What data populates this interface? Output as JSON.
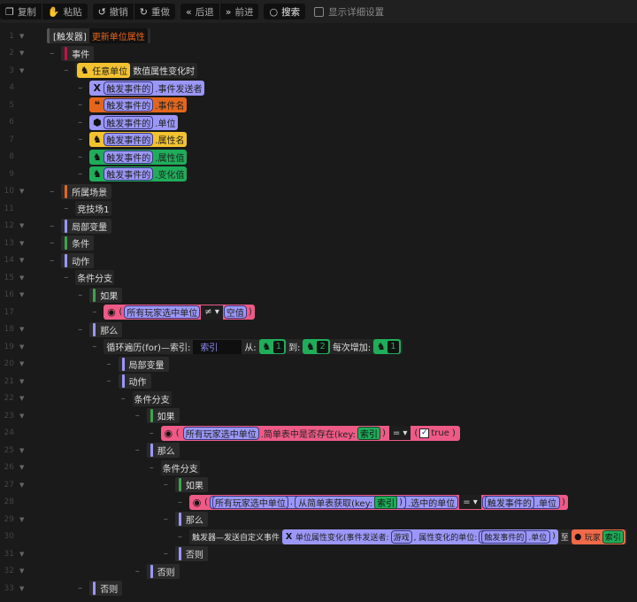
{
  "toolbar": {
    "copy": "复制",
    "paste": "粘贴",
    "undo": "撤销",
    "redo": "重做",
    "back": "后退",
    "forward": "前进",
    "search": "搜索",
    "show_details": "显示详细设置"
  },
  "colors": {
    "purple": "#9b97f7",
    "orange": "#e4661c",
    "yellow": "#f3c22f",
    "green": "#1fad5a",
    "pink": "#ee5a86",
    "event_red": "#c0144a"
  },
  "rows": [
    {
      "n": "1",
      "lv": 0,
      "ar": true,
      "c": [
        {
          "k": "hdr",
          "c": [
            {
              "k": "t",
              "t": "[触发器]"
            },
            {
              "k": "darkorange",
              "t": "更新单位属性"
            }
          ]
        }
      ]
    },
    {
      "n": "2",
      "lv": 1,
      "ar": true,
      "c": [
        {
          "k": "bar",
          "bc": "#c0144a",
          "t": "事件"
        }
      ]
    },
    {
      "n": "3",
      "lv": 2,
      "ar": true,
      "c": [
        {
          "k": "grp",
          "c": [
            {
              "k": "blk yellow",
              "c": [
                {
                  "k": "icon",
                  "i": "unit-icon"
                },
                {
                  "k": "t",
                  "t": "任意单位"
                }
              ]
            },
            {
              "k": "t",
              "t": "数值属性变化时"
            }
          ]
        }
      ]
    },
    {
      "n": "4",
      "lv": 3,
      "c": [
        {
          "k": "blk purple",
          "c": [
            {
              "k": "icon",
              "i": "x-icon"
            },
            {
              "k": "pbox",
              "t": "触发事件的"
            },
            {
              "k": "t",
              "t": ".事件发送者"
            }
          ]
        }
      ]
    },
    {
      "n": "5",
      "lv": 3,
      "c": [
        {
          "k": "blk orange",
          "c": [
            {
              "k": "icon",
              "i": "quote-icon"
            },
            {
              "k": "pbox",
              "t": "触发事件的"
            },
            {
              "k": "t",
              "t": ".事件名"
            }
          ]
        }
      ]
    },
    {
      "n": "6",
      "lv": 3,
      "c": [
        {
          "k": "blk purple",
          "c": [
            {
              "k": "icon",
              "i": "cube-icon"
            },
            {
              "k": "pbox",
              "t": "触发事件的"
            },
            {
              "k": "t",
              "t": ".单位"
            }
          ]
        }
      ]
    },
    {
      "n": "7",
      "lv": 3,
      "c": [
        {
          "k": "blk yellow",
          "c": [
            {
              "k": "icon",
              "i": "unit-icon"
            },
            {
              "k": "pbox",
              "t": "触发事件的"
            },
            {
              "k": "t",
              "t": ".属性名"
            }
          ]
        }
      ]
    },
    {
      "n": "8",
      "lv": 3,
      "c": [
        {
          "k": "blk green",
          "c": [
            {
              "k": "icon",
              "i": "unit-icon"
            },
            {
              "k": "pbox",
              "t": "触发事件的"
            },
            {
              "k": "t",
              "t": ".属性值"
            }
          ]
        }
      ]
    },
    {
      "n": "9",
      "lv": 3,
      "c": [
        {
          "k": "blk green",
          "c": [
            {
              "k": "icon",
              "i": "unit-icon"
            },
            {
              "k": "pbox",
              "t": "触发事件的"
            },
            {
              "k": "t",
              "t": ".变化值"
            }
          ]
        }
      ]
    },
    {
      "n": "10",
      "lv": 1,
      "ar": true,
      "c": [
        {
          "k": "bar",
          "bc": "#e4661c",
          "t": "所属场景"
        }
      ]
    },
    {
      "n": "11",
      "lv": 2,
      "c": [
        {
          "k": "grp",
          "t": "竞技场1"
        }
      ]
    },
    {
      "n": "12",
      "lv": 1,
      "ar": true,
      "c": [
        {
          "k": "bar",
          "bc": "#9b97f7",
          "t": "局部变量"
        }
      ]
    },
    {
      "n": "13",
      "lv": 1,
      "ar": true,
      "c": [
        {
          "k": "bar",
          "bc": "#3fa34d",
          "t": "条件"
        }
      ]
    },
    {
      "n": "14",
      "lv": 1,
      "ar": true,
      "c": [
        {
          "k": "bar",
          "bc": "#9b97f7",
          "t": "动作"
        }
      ]
    },
    {
      "n": "15",
      "lv": 2,
      "ar": true,
      "c": [
        {
          "k": "grp",
          "t": "条件分支"
        }
      ]
    },
    {
      "n": "16",
      "lv": 3,
      "ar": true,
      "c": [
        {
          "k": "bar",
          "bc": "#3fa34d",
          "t": "如果"
        }
      ]
    },
    {
      "n": "17",
      "lv": 4,
      "c": [
        {
          "k": "blk pink",
          "c": [
            {
              "k": "icon",
              "i": "eye-icon"
            },
            {
              "k": "t",
              "t": "("
            },
            {
              "k": "pbox",
              "t": "所有玩家选中单位"
            },
            {
              "k": "dd",
              "t": "≠ ▾"
            },
            {
              "k": "pbox",
              "t": "空值"
            },
            {
              "k": "t",
              "t": ")"
            }
          ]
        }
      ]
    },
    {
      "n": "18",
      "lv": 3,
      "ar": true,
      "c": [
        {
          "k": "bar",
          "bc": "#9b97f7",
          "t": "那么"
        }
      ]
    },
    {
      "n": "19",
      "lv": 4,
      "ar": true,
      "c": [
        {
          "k": "grp",
          "c": [
            {
              "k": "t",
              "t": "循环遍历(for)—索引:"
            },
            {
              "k": "input",
              "t": "索引"
            },
            {
              "k": "t",
              "t": "从:"
            },
            {
              "k": "blk green",
              "c": [
                {
                  "k": "icon",
                  "i": "unit-icon"
                },
                {
                  "k": "num",
                  "t": "1"
                }
              ]
            },
            {
              "k": "t",
              "t": "到:"
            },
            {
              "k": "blk green",
              "c": [
                {
                  "k": "icon",
                  "i": "unit-icon"
                },
                {
                  "k": "num",
                  "t": "2"
                }
              ]
            },
            {
              "k": "t",
              "t": "每次增加:"
            },
            {
              "k": "blk green",
              "c": [
                {
                  "k": "icon",
                  "i": "unit-icon"
                },
                {
                  "k": "num",
                  "t": "1"
                }
              ]
            }
          ]
        }
      ]
    },
    {
      "n": "20",
      "lv": 5,
      "ar": true,
      "c": [
        {
          "k": "bar",
          "bc": "#9b97f7",
          "t": "局部变量"
        }
      ]
    },
    {
      "n": "21",
      "lv": 5,
      "ar": true,
      "c": [
        {
          "k": "bar",
          "bc": "#9b97f7",
          "t": "动作"
        }
      ]
    },
    {
      "n": "22",
      "lv": 6,
      "ar": true,
      "c": [
        {
          "k": "grp",
          "t": "条件分支"
        }
      ]
    },
    {
      "n": "23",
      "lv": 7,
      "ar": true,
      "c": [
        {
          "k": "bar",
          "bc": "#3fa34d",
          "t": "如果"
        }
      ]
    },
    {
      "n": "24",
      "lv": 8,
      "c": [
        {
          "k": "blk pink",
          "c": [
            {
              "k": "icon",
              "i": "eye-icon"
            },
            {
              "k": "t",
              "t": "("
            },
            {
              "k": "blk pink",
              "c": [
                {
                  "k": "pbox",
                  "t": "所有玩家选中单位"
                },
                {
                  "k": "t",
                  "t": ".简单表中是否存在(key:"
                },
                {
                  "k": "gbox",
                  "t": "索引"
                },
                {
                  "k": "t",
                  "t": ")"
                }
              ]
            },
            {
              "k": "dd",
              "t": "= ▾"
            },
            {
              "k": "blk pink",
              "c": [
                {
                  "k": "t",
                  "t": "("
                },
                {
                  "k": "check",
                  "i": "checkbox-icon",
                  "t": "✓"
                },
                {
                  "k": "t",
                  "t": "true"
                },
                {
                  "k": "t",
                  "t": ")"
                }
              ]
            }
          ]
        }
      ]
    },
    {
      "n": "25",
      "lv": 7,
      "ar": true,
      "c": [
        {
          "k": "bar",
          "bc": "#9b97f7",
          "t": "那么"
        }
      ]
    },
    {
      "n": "26",
      "lv": 8,
      "ar": true,
      "c": [
        {
          "k": "grp",
          "t": "条件分支"
        }
      ]
    },
    {
      "n": "27",
      "lv": 9,
      "ar": true,
      "c": [
        {
          "k": "bar",
          "bc": "#3fa34d",
          "t": "如果"
        }
      ]
    },
    {
      "n": "28",
      "lv": 10,
      "c": [
        {
          "k": "blk pink",
          "c": [
            {
              "k": "icon",
              "i": "eye-icon"
            },
            {
              "k": "t",
              "t": "("
            },
            {
              "k": "pbox",
              "c": [
                {
                  "k": "pbox",
                  "t": "所有玩家选中单位"
                },
                {
                  "k": "t",
                  "t": "."
                },
                {
                  "k": "pbox",
                  "c": [
                    {
                      "k": "t",
                      "t": "从简单表获取(key:"
                    },
                    {
                      "k": "gbox",
                      "t": "索引"
                    },
                    {
                      "k": "t",
                      "t": ")"
                    }
                  ]
                },
                {
                  "k": "t",
                  "t": ".选中的单位"
                }
              ]
            },
            {
              "k": "dd",
              "t": "= ▾"
            },
            {
              "k": "pbox",
              "c": [
                {
                  "k": "pbox",
                  "t": "触发事件的"
                },
                {
                  "k": "t",
                  "t": ".单位"
                }
              ]
            },
            {
              "k": "t",
              "t": ")"
            }
          ]
        }
      ]
    },
    {
      "n": "29",
      "lv": 9,
      "ar": true,
      "c": [
        {
          "k": "bar",
          "bc": "#9b97f7",
          "t": "那么"
        }
      ]
    },
    {
      "n": "30",
      "lv": 10,
      "c": [
        {
          "k": "grp",
          "c": [
            {
              "k": "t",
              "t": "触发器—发送自定义事件"
            },
            {
              "k": "blk purple",
              "c": [
                {
                  "k": "icon",
                  "i": "x-icon"
                },
                {
                  "k": "t",
                  "t": "单位属性变化(事件发送者:"
                },
                {
                  "k": "pbox",
                  "t": "游戏"
                },
                {
                  "k": "t",
                  "t": ", 属性变化的单位:"
                },
                {
                  "k": "pbox",
                  "c": [
                    {
                      "k": "pbox",
                      "t": "触发事件的"
                    },
                    {
                      "k": "t",
                      "t": ".单位"
                    }
                  ]
                },
                {
                  "k": "t",
                  "t": ")"
                }
              ]
            },
            {
              "k": "t",
              "t": "至"
            },
            {
              "k": "blk salmon",
              "c": [
                {
                  "k": "icon",
                  "i": "player-icon"
                },
                {
                  "k": "t",
                  "t": "玩家"
                },
                {
                  "k": "gbox",
                  "t": "索引"
                }
              ]
            }
          ]
        }
      ]
    },
    {
      "n": "31",
      "lv": 9,
      "ar": true,
      "c": [
        {
          "k": "bar",
          "bc": "#9b97f7",
          "t": "否则"
        }
      ]
    },
    {
      "n": "32",
      "lv": 7,
      "ar": true,
      "c": [
        {
          "k": "bar",
          "bc": "#9b97f7",
          "t": "否则"
        }
      ]
    },
    {
      "n": "33",
      "lv": 3,
      "ar": true,
      "c": [
        {
          "k": "bar",
          "bc": "#9b97f7",
          "t": "否则"
        }
      ]
    }
  ]
}
